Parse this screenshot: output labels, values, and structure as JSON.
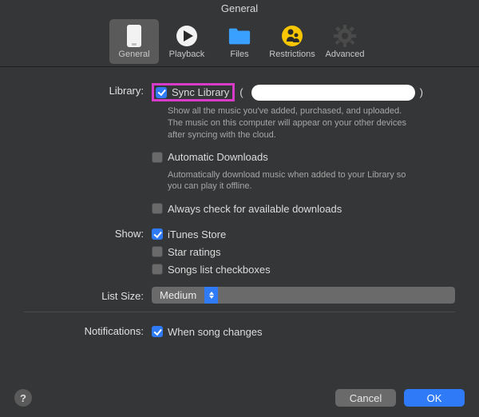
{
  "title": "General",
  "toolbar": {
    "items": [
      {
        "label": "General"
      },
      {
        "label": "Playback"
      },
      {
        "label": "Files"
      },
      {
        "label": "Restrictions"
      },
      {
        "label": "Advanced"
      }
    ]
  },
  "sections": {
    "library": {
      "label": "Library:",
      "sync": {
        "label": "Sync Library",
        "checked": true
      },
      "sync_desc": "Show all the music you've added, purchased, and uploaded. The music on this computer will appear on your other devices after syncing with the cloud.",
      "auto_dl": {
        "label": "Automatic Downloads",
        "checked": false
      },
      "auto_dl_desc": "Automatically download music when added to your Library so you can play it offline.",
      "always_check": {
        "label": "Always check for available downloads",
        "checked": false
      }
    },
    "show": {
      "label": "Show:",
      "itunes_store": {
        "label": "iTunes Store",
        "checked": true
      },
      "star_ratings": {
        "label": "Star ratings",
        "checked": false
      },
      "songs_cb": {
        "label": "Songs list checkboxes",
        "checked": false
      }
    },
    "list_size": {
      "label": "List Size:",
      "value": "Medium"
    },
    "notifications": {
      "label": "Notifications:",
      "song_changes": {
        "label": "When song changes",
        "checked": true
      }
    }
  },
  "footer": {
    "cancel": "Cancel",
    "ok": "OK"
  }
}
